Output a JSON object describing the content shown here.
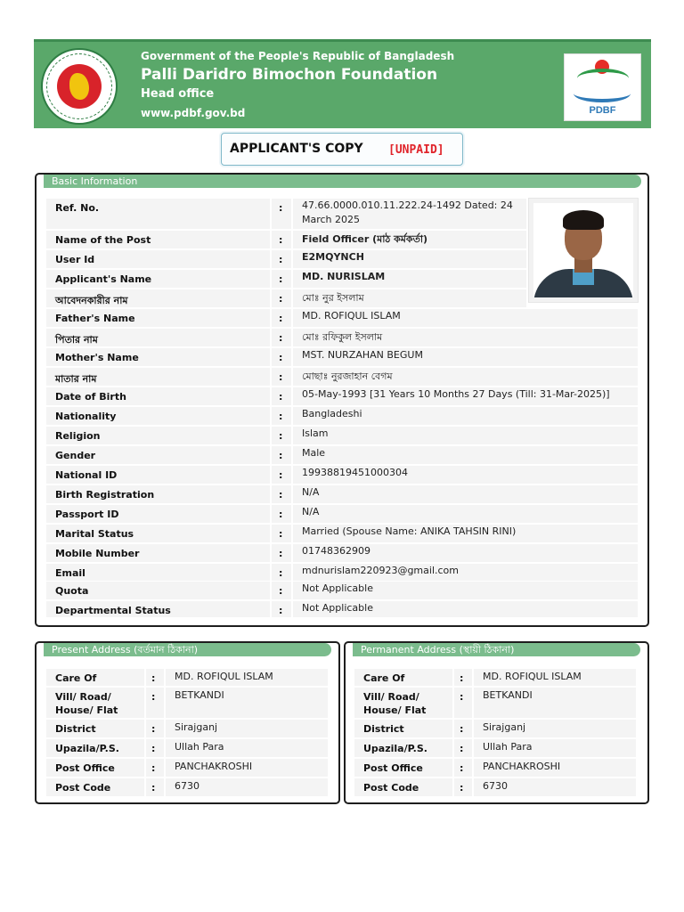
{
  "header": {
    "line1": "Government of the People's Republic of Bangladesh",
    "line2": "Palli Daridro Bimochon Foundation",
    "line3": "Head office",
    "line4": "www.pdbf.gov.bd",
    "logo_text": "PDBF"
  },
  "copy": {
    "title": "APPLICANT'S COPY",
    "status": "[UNPAID]"
  },
  "basic": {
    "title": "Basic Information",
    "rows": [
      {
        "label": "Ref. No.",
        "value": "47.66.0000.010.11.222.24-1492 Dated: 24",
        "value2": "March 2025"
      },
      {
        "label": "Name of the Post",
        "value": "Field Officer (মাঠ কর্মকর্তা)"
      },
      {
        "label": "User Id",
        "value": "E2MQYNCH"
      },
      {
        "label": "Applicant's Name",
        "value": "MD. NURISLAM"
      },
      {
        "label": "আবেদনকারীর নাম",
        "value": "মোঃ নুর ইসলাম"
      },
      {
        "label": "Father's Name",
        "value": "MD. ROFIQUL ISLAM"
      },
      {
        "label": "পিতার নাম",
        "value": "মোঃ রফিকুল ইসলাম"
      },
      {
        "label": "Mother's Name",
        "value": "MST. NURZAHAN BEGUM"
      },
      {
        "label": "মাতার নাম",
        "value": "মোছাঃ নুরজাহান বেগম"
      },
      {
        "label": "Date of Birth",
        "value": "05-May-1993 [31 Years 10 Months 27 Days (Till: 31-Mar-2025)]"
      },
      {
        "label": "Nationality",
        "value": "Bangladeshi"
      },
      {
        "label": "Religion",
        "value": "Islam"
      },
      {
        "label": "Gender",
        "value": "Male"
      },
      {
        "label": "National ID",
        "value": "19938819451000304"
      },
      {
        "label": "Birth Registration",
        "value": "N/A"
      },
      {
        "label": "Passport ID",
        "value": "N/A"
      },
      {
        "label": "Marital Status",
        "value": "Married (Spouse Name: ANIKA TAHSIN RINI)"
      },
      {
        "label": "Mobile Number",
        "value": "01748362909"
      },
      {
        "label": "Email",
        "value": "mdnurislam220923@gmail.com"
      },
      {
        "label": "Quota",
        "value": "Not Applicable"
      },
      {
        "label": "Departmental Status",
        "value": "Not Applicable"
      }
    ]
  },
  "present": {
    "title": "Present Address (বর্তমান ঠিকানা)",
    "rows": [
      {
        "label": "Care Of",
        "value": "MD. ROFIQUL ISLAM"
      },
      {
        "label": "Vill/ Road/",
        "label2": "House/ Flat",
        "value": "BETKANDI"
      },
      {
        "label": "District",
        "value": "Sirajganj"
      },
      {
        "label": "Upazila/P.S.",
        "value": "Ullah Para"
      },
      {
        "label": "Post Office",
        "value": "PANCHAKROSHI"
      },
      {
        "label": "Post Code",
        "value": "6730"
      }
    ]
  },
  "permanent": {
    "title": "Permanent Address (স্থায়ী ঠিকানা)",
    "rows": [
      {
        "label": "Care Of",
        "value": "MD. ROFIQUL ISLAM"
      },
      {
        "label": "Vill/ Road/",
        "label2": "House/ Flat",
        "value": "BETKANDI"
      },
      {
        "label": "District",
        "value": "Sirajganj"
      },
      {
        "label": "Upazila/P.S.",
        "value": "Ullah Para"
      },
      {
        "label": "Post Office",
        "value": "PANCHAKROSHI"
      },
      {
        "label": "Post Code",
        "value": "6730"
      }
    ]
  },
  "colon": ":",
  "colors": {
    "header_bg": "#5aa86a",
    "section_title_bg": "#7bbc8d",
    "status_red": "#e0242a"
  }
}
